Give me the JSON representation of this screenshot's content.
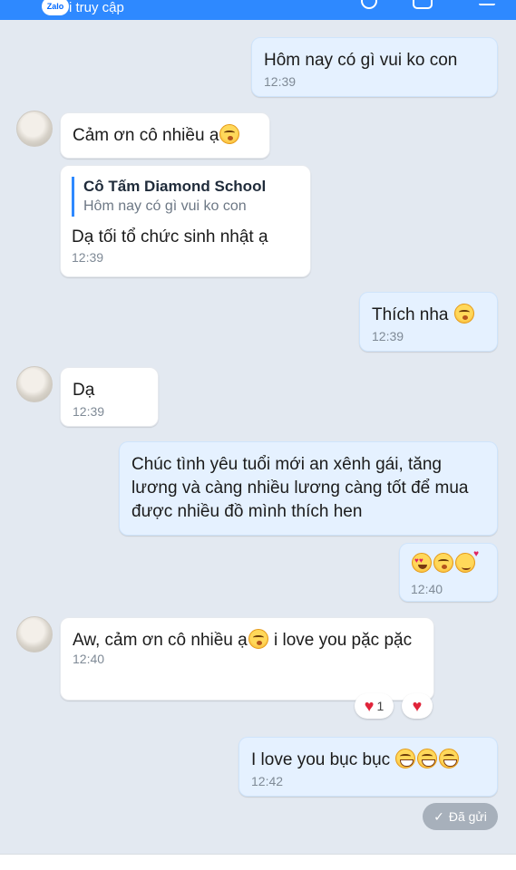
{
  "header": {
    "logo": "Zalo",
    "title": "i truy cập"
  },
  "messages": [
    {
      "text": "Hôm nay có gì vui ko con",
      "time": "12:39"
    },
    {
      "text": "Cảm ơn cô nhiều ạ"
    },
    {
      "quote_name": "Cô Tấm Diamond School",
      "quote_text": "Hôm nay có gì vui ko con",
      "text": "Dạ tối tổ chức sinh nhật ạ",
      "time": "12:39"
    },
    {
      "text": "Thích nha",
      "time": "12:39"
    },
    {
      "text": "Dạ",
      "time": "12:39"
    },
    {
      "text": "Chúc tình yêu tuổi mới an xênh gái, tăng lương và càng nhiều lương càng tốt để mua được nhiều đồ mình thích hen"
    },
    {
      "time": "12:40"
    },
    {
      "text_before": "Aw, cảm ơn cô nhiều ạ",
      "text_after": " i love you pặc pặc",
      "time": "12:40",
      "reaction_count": "1"
    },
    {
      "text": "I love you bục bục",
      "time": "12:42"
    }
  ],
  "status": {
    "label": "Đã gửi",
    "check": "✓"
  },
  "icons": {
    "heart": "♥"
  },
  "colors": {
    "header": "#2e89ff",
    "my_bubble": "#e5f1ff",
    "background": "#e3e9f1"
  }
}
